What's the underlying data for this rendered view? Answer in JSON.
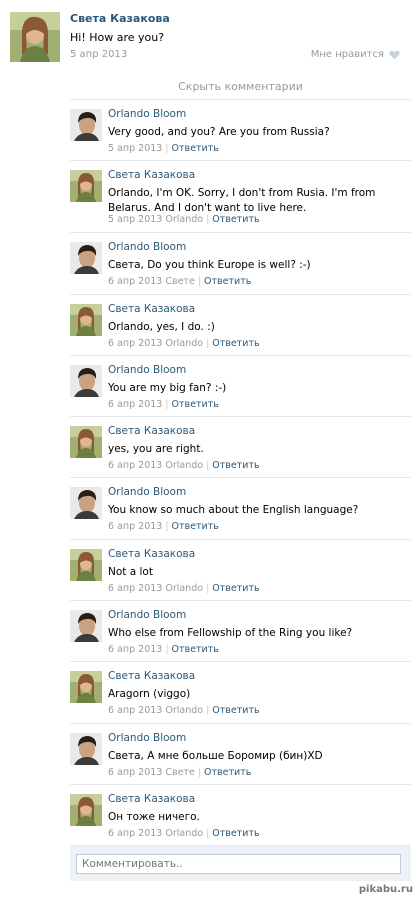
{
  "post": {
    "author": "Света Казакова",
    "text": "Hi! How are you?",
    "date": "5 апр 2013",
    "like_label": "Мне нравится"
  },
  "hide_comments_label": "Скрыть комментарии",
  "comments": [
    {
      "author": "Orlando Bloom",
      "avatar": "orlando",
      "text": "Very good, and you? Are you from Russia?",
      "date": "5 апр 2013",
      "to": "",
      "reply": "Ответить"
    },
    {
      "author": "Света Казакова",
      "avatar": "sveta",
      "text": "Orlando, I'm OK. Sorry, I don't from Rusia. I'm from Belarus. And I don't want to live here.",
      "date": "5 апр 2013",
      "to": "Orlando",
      "reply": "Ответить"
    },
    {
      "author": "Orlando Bloom",
      "avatar": "orlando",
      "text": "Света, Do you think Europe is well? :-)",
      "date": "6 апр 2013",
      "to": "Свете",
      "reply": "Ответить"
    },
    {
      "author": "Света Казакова",
      "avatar": "sveta",
      "text": "Orlando, yes, I do. :)",
      "date": "6 апр 2013",
      "to": "Orlando",
      "reply": "Ответить"
    },
    {
      "author": "Orlando Bloom",
      "avatar": "orlando",
      "text": "You are my big fan? :-)",
      "date": "6 апр 2013",
      "to": "",
      "reply": "Ответить"
    },
    {
      "author": "Света Казакова",
      "avatar": "sveta",
      "text": "yes, you are right.",
      "date": "6 апр 2013",
      "to": "Orlando",
      "reply": "Ответить"
    },
    {
      "author": "Orlando Bloom",
      "avatar": "orlando",
      "text": "You know so much about the English language?",
      "date": "6 апр 2013",
      "to": "",
      "reply": "Ответить"
    },
    {
      "author": "Света Казакова",
      "avatar": "sveta",
      "text": "Not a lot",
      "date": "6 апр 2013",
      "to": "Orlando",
      "reply": "Ответить"
    },
    {
      "author": "Orlando Bloom",
      "avatar": "orlando",
      "text": "Who else from Fellowship of the Ring you like?",
      "date": "6 апр 2013",
      "to": "",
      "reply": "Ответить"
    },
    {
      "author": "Света Казакова",
      "avatar": "sveta",
      "text": "Aragorn (viggo)",
      "date": "6 апр 2013",
      "to": "Orlando",
      "reply": "Ответить"
    },
    {
      "author": "Orlando Bloom",
      "avatar": "orlando",
      "text": "Света, А мне больше Боромир (бин)XD",
      "date": "6 апр 2013",
      "to": "Свете",
      "reply": "Ответить"
    },
    {
      "author": "Света Казакова",
      "avatar": "sveta",
      "text": "Он тоже ничего.",
      "date": "6 апр 2013",
      "to": "Orlando",
      "reply": "Ответить"
    }
  ],
  "compose": {
    "placeholder": "Комментировать.."
  },
  "watermark": "pikabu.ru",
  "colors": {
    "link": "#2b587a",
    "meta": "#999999",
    "divider": "#e4e8ed",
    "compose_bg": "#eef1f5"
  }
}
